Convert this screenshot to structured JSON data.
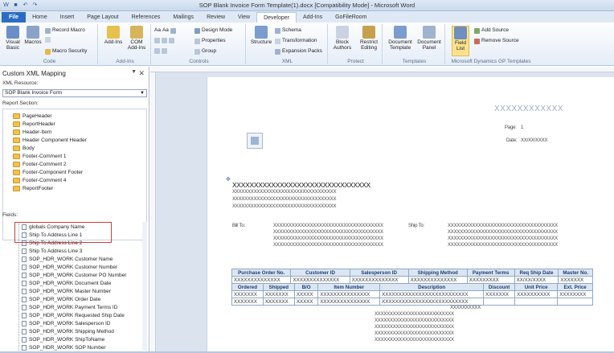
{
  "window": {
    "title": "SOP Blank Invoice Form Template(1).docx [Compatibility Mode] - Microsoft Word"
  },
  "tabs": [
    "File",
    "Home",
    "Insert",
    "Page Layout",
    "References",
    "Mailings",
    "Review",
    "View",
    "Developer",
    "Add-Ins",
    "GoFileRoom"
  ],
  "ribbon": {
    "code": {
      "label": "Code",
      "visual_basic": "Visual Basic",
      "macros": "Macros",
      "record_macro": "Record Macro",
      "pause_recording": "",
      "macro_security": "Macro Security"
    },
    "addins": {
      "label": "Add-Ins",
      "add_ins": "Add-Ins",
      "com_add_ins": "COM Add-Ins"
    },
    "controls": {
      "label": "Controls",
      "design_mode": "Design Mode",
      "properties": "Properties",
      "group": "Group"
    },
    "xml": {
      "label": "XML",
      "structure": "Structure",
      "schema": "Schema",
      "transformation": "Transformation",
      "expansion_packs": "Expansion Packs"
    },
    "protect": {
      "label": "Protect",
      "block_authors": "Block Authors",
      "restrict_editing": "Restrict Editing"
    },
    "templates": {
      "label": "Templates",
      "document_template": "Document Template",
      "document_panel": "Document Panel"
    },
    "gp": {
      "label": "Microsoft Dynamics GP Templates",
      "field_list": "Field List",
      "add_source": "Add Source",
      "remove_source": "Remove Source"
    }
  },
  "pane": {
    "title": "Custom XML Mapping",
    "xml_resource_label": "XML Resource:",
    "xml_resource_value": "SOP Blank Invoice Form",
    "report_section_label": "Report Section:",
    "sections": [
      "PageHeader",
      "ReportHeader",
      "Header-Item",
      "Header Component Header",
      "Body",
      "Footer-Comment 1",
      "Footer-Comment 2",
      "Footer-Component Footer",
      "Footer-Comment 4",
      "ReportFooter"
    ],
    "fields_label": "Fields:",
    "fields": [
      "globals Company Name",
      "Ship To Address Line 1",
      "Ship To Address Line 2",
      "Ship To Address Line 3",
      "SOP_HDR_WORK Customer Name",
      "SOP_HDR_WORK Customer Number",
      "SOP_HDR_WORK Customer PO Number",
      "SOP_HDR_WORK Document Date",
      "SOP_HDR_WORK Master Number",
      "SOP_HDR_WORK Order Date",
      "SOP_HDR_WORK Payment Terms ID",
      "SOP_HDR_WORK Requested Ship Date",
      "SOP_HDR_WORK Salesperson ID",
      "SOP_HDR_WORK Shipping Method",
      "SOP_HDR_WORK ShipToName",
      "SOP_HDR_WORK SOP Number"
    ]
  },
  "document": {
    "top_right_x": "XXXXXXXXXXXX",
    "page_label": "Page:",
    "page_value": "1",
    "date_label": "Date:",
    "date_value": "XX/XX/XXXX",
    "company_x": "XXXXXXXXXXXXXXXXXXXXXXXXXXXXXXXX",
    "company_lines": [
      "XXXXXXXXXXXXXXXXXXXXXXXXXXXXXXXXXX",
      "XXXXXXXXXXXXXXXXXXXXXXXXXXXXXXXXXX",
      "XXXXXXXXXXXXXXXXXXXXXXXXXXXXXXXXXX"
    ],
    "bill_to_label": "Bill To:",
    "ship_to_label": "Ship To:",
    "addr_lines": [
      "XXXXXXXXXXXXXXXXXXXXXXXXXXXXXXXXXXXX",
      "XXXXXXXXXXXXXXXXXXXXXXXXXXXXXXXXXXXX",
      "XXXXXXXXXXXXXXXXXXXXXXXXXXXXXXXXXXXX",
      "XXXXXXXXXXXXXXXXXXXXXXXXXXXXXXXXXXXX"
    ],
    "table1_headers": [
      "Purchase Order No.",
      "Customer ID",
      "Salesperson ID",
      "Shipping Method",
      "Payment Terms",
      "Req Ship Date",
      "Master No."
    ],
    "table1_values": [
      "XXXXXXXXXXXXXX",
      "XXXXXXXXXXXXXX",
      "XXXXXXXXXXXXXX",
      "XXXXXXXXXXXXXX",
      "XXXXXXXXX",
      "XX/XX/XXXX",
      "XXXXXXX"
    ],
    "table2_headers": [
      "Ordered",
      "Shipped",
      "B/O",
      "Item Number",
      "Description",
      "Discount",
      "Unit Price",
      "Ext. Price"
    ],
    "table2_row1": [
      "XXXXXXX",
      "XXXXXXX",
      "XXXXX",
      "XXXXXXXXXXXXXXX",
      "XXXXXXXXXXXXXXXXXXXXXXXXXX",
      "XXXXXXX",
      "XXXXXXXXXX",
      "XXXXXXXX"
    ],
    "table2_row2": [
      "XXXXXXX",
      "XXXXXXX",
      "XXXXX",
      "XXXXXXXXXXXXXXX",
      "XXXXXXXXXXXXXXXXXXXXXXXXXX",
      "",
      "",
      ""
    ],
    "desc_lines": [
      "XXXXXXXXXX",
      "XXXXXXXXXXXXXXXXXXXXXXXXXX",
      "XXXXXXXXXXXXXXXXXXXXXXXXXX",
      "XXXXXXXXXXXXXXXXXXXXXXXXXX",
      "XXXXXXXXXXXXXXXXXXXXXXXXXX",
      "XXXXXXXXXXXXXXXXXXXXXXXXXX"
    ]
  },
  "colors": {
    "accent": "#2b6cc4",
    "highlight_box": "#d23c3c",
    "table_header": "#dce6f3"
  }
}
